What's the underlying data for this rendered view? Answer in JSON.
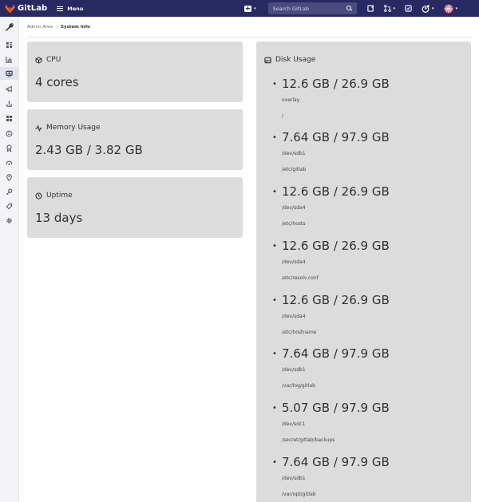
{
  "navbar": {
    "brand": "GitLab",
    "menu_label": "Menu",
    "search_placeholder": "Search GitLab"
  },
  "breadcrumb": {
    "parent": "Admin Area",
    "current": "System Info"
  },
  "cards": {
    "cpu": {
      "title": "CPU",
      "value": "4 cores"
    },
    "memory": {
      "title": "Memory Usage",
      "value": "2.43 GB / 3.82 GB"
    },
    "uptime": {
      "title": "Uptime",
      "value": "13 days"
    }
  },
  "disk": {
    "title": "Disk Usage",
    "items": [
      {
        "size": "12.6 GB / 26.9 GB",
        "device": "overlay",
        "mount": "/"
      },
      {
        "size": "7.64 GB / 97.9 GB",
        "device": "/dev/sdb1",
        "mount": "/etc/gitlab"
      },
      {
        "size": "12.6 GB / 26.9 GB",
        "device": "/dev/sda4",
        "mount": "/etc/hosts"
      },
      {
        "size": "12.6 GB / 26.9 GB",
        "device": "/dev/sda4",
        "mount": "/etc/resolv.conf"
      },
      {
        "size": "12.6 GB / 26.9 GB",
        "device": "/dev/sda4",
        "mount": "/etc/hostname"
      },
      {
        "size": "7.64 GB / 97.9 GB",
        "device": "/dev/sdb1",
        "mount": "/var/log/gitlab"
      },
      {
        "size": "5.07 GB / 97.9 GB",
        "device": "/dev/sdc1",
        "mount": "/secret/gitlab/backups"
      },
      {
        "size": "7.64 GB / 97.9 GB",
        "device": "/dev/sdb1",
        "mount": "/var/opt/gitlab"
      }
    ]
  },
  "colors": {
    "navbar_bg": "#292961",
    "card_bg": "#dcdcdc",
    "logo_orange": "#e24329"
  }
}
